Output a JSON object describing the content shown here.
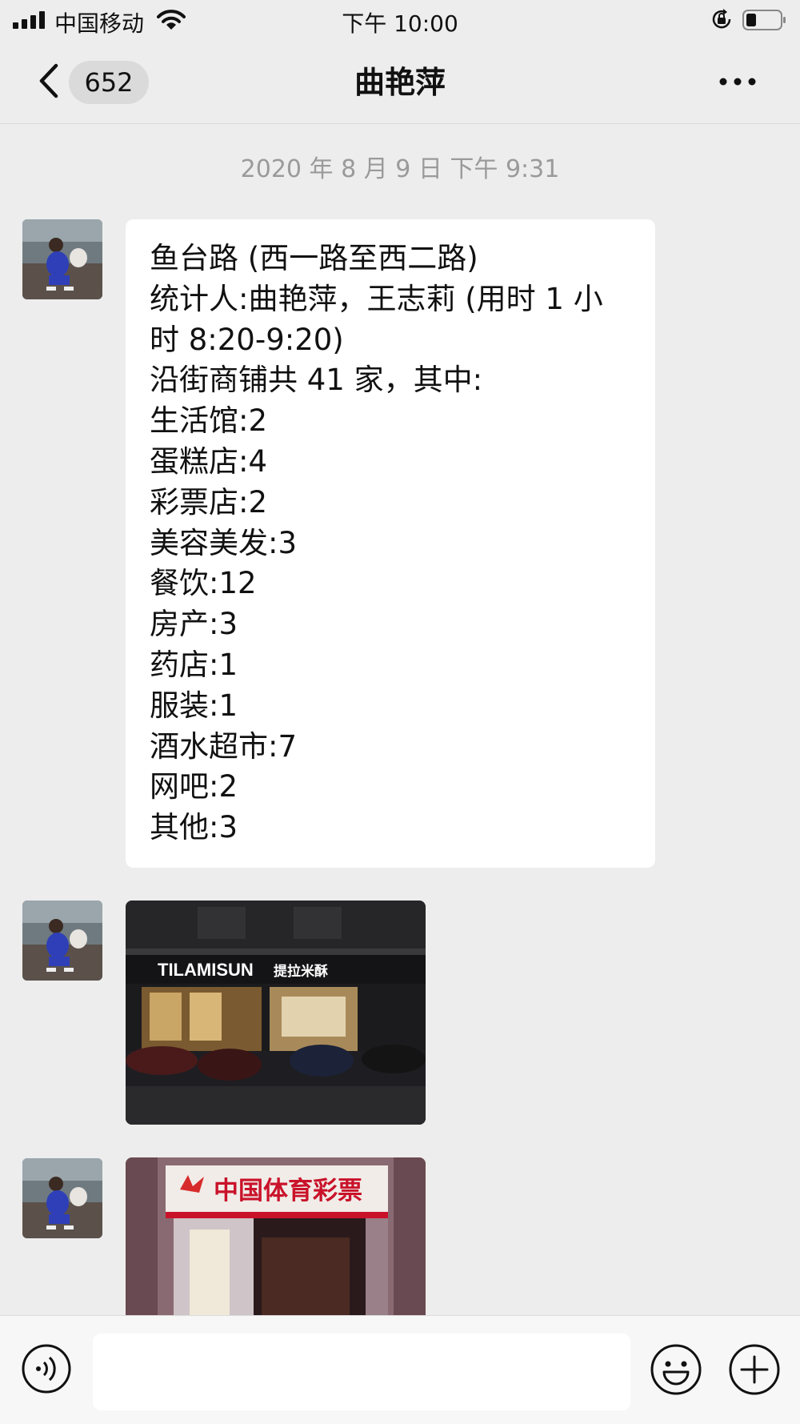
{
  "status_bar": {
    "carrier": "中国移动",
    "time": "下午 10:00"
  },
  "nav": {
    "unread_count": "652",
    "title": "曲艳萍"
  },
  "timestamp": "2020 年 8 月 9 日 下午 9:31",
  "message": {
    "lines": [
      "鱼台路 (西一路至西二路)",
      "统计人:曲艳萍，王志莉 (用时 1 小",
      "时 8:20-9:20)",
      "沿街商铺共 41 家，其中:",
      "生活馆:2",
      "蛋糕店:4",
      "彩票店:2",
      "美容美发:3",
      "餐饮:12",
      "房产:3",
      "药店:1",
      "服装:1",
      "酒水超市:7",
      "网吧:2",
      "其他:3"
    ]
  },
  "photos": [
    {
      "sign_brand": "TILAMISUN",
      "sign_cn": "提拉米酥"
    },
    {
      "sign_cn": "中国体育彩票"
    }
  ]
}
